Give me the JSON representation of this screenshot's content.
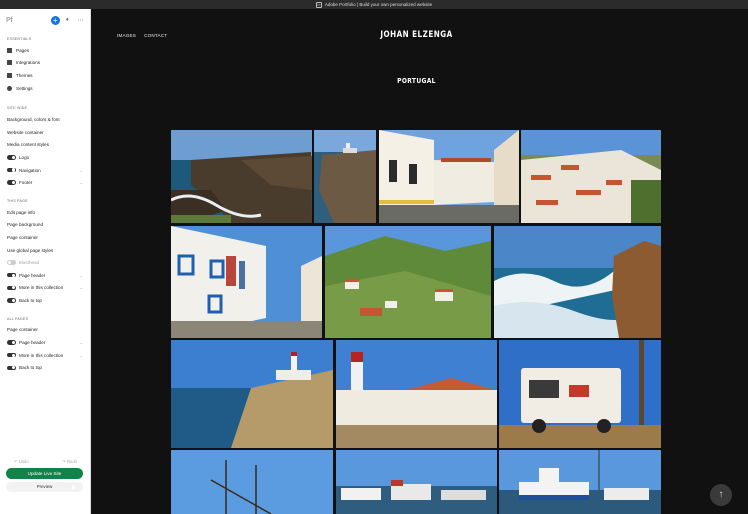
{
  "window": {
    "title": "Adobe Portfolio | Build your own personalized website",
    "pf_label": "Pf"
  },
  "sidebar": {
    "logo": "Pf",
    "essentials": {
      "heading": "ESSENTIALS",
      "items": [
        "Pages",
        "Integrations",
        "Themes",
        "Settings"
      ]
    },
    "site_wide": {
      "heading": "SITE WIDE",
      "links": [
        "Background, colors & font",
        "Website container",
        "Media content styles"
      ],
      "toggles": [
        {
          "label": "Logo",
          "on": true,
          "chevron": false
        },
        {
          "label": "Navigation",
          "on": true,
          "chevron": true
        },
        {
          "label": "Footer",
          "on": true,
          "chevron": true
        }
      ]
    },
    "this_page": {
      "heading": "THIS PAGE",
      "links": [
        "Edit page info",
        "Page background",
        "Page container",
        "Use global page styles"
      ],
      "toggles": [
        {
          "label": "Masthead",
          "on": false,
          "chevron": false,
          "dim": true
        },
        {
          "label": "Page header",
          "on": true,
          "chevron": true
        },
        {
          "label": "More in this collection",
          "on": true,
          "chevron": true
        },
        {
          "label": "Back to top",
          "on": true,
          "chevron": false
        }
      ]
    },
    "all_pages": {
      "heading": "ALL PAGES",
      "links": [
        "Page container"
      ],
      "toggles": [
        {
          "label": "Page header",
          "on": true,
          "chevron": true
        },
        {
          "label": "More in this collection",
          "on": true,
          "chevron": true
        },
        {
          "label": "Back to top",
          "on": true,
          "chevron": false
        }
      ]
    },
    "undo": "Undo",
    "redo": "Redo",
    "update_button": "Update Live Site",
    "preview_button": "Preview"
  },
  "site": {
    "nav": [
      "IMAGES",
      "CONTACT"
    ],
    "title": "JOHAN ELZENGA",
    "page_title": "PORTUGAL",
    "gallery": [
      {
        "name": "cliffs-sea",
        "theme": "cliff"
      },
      {
        "name": "lighthouse-cliff",
        "theme": "cliff-lh"
      },
      {
        "name": "white-street",
        "theme": "street"
      },
      {
        "name": "village-hill",
        "theme": "village"
      },
      {
        "name": "laundry-street",
        "theme": "street2"
      },
      {
        "name": "green-valley",
        "theme": "valley"
      },
      {
        "name": "waves-rocks",
        "theme": "waves"
      },
      {
        "name": "lighthouse-coast",
        "theme": "coast"
      },
      {
        "name": "red-lighthouse",
        "theme": "lh"
      },
      {
        "name": "camper-van",
        "theme": "camper"
      },
      {
        "name": "sailboat-masts",
        "theme": "mast"
      },
      {
        "name": "harbor-boats",
        "theme": "harbor"
      },
      {
        "name": "fishing-boat",
        "theme": "boat"
      }
    ]
  },
  "colors": {
    "accent": "#1473e6",
    "update": "#12824b",
    "canvas": "#111111"
  }
}
